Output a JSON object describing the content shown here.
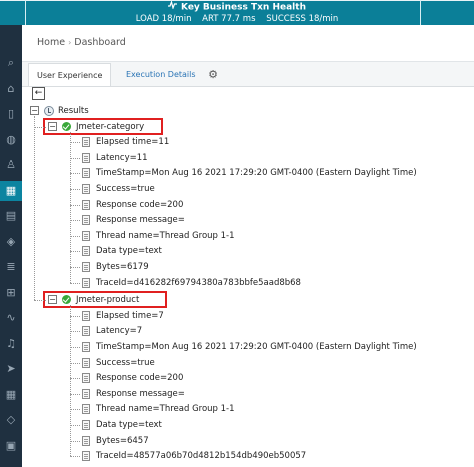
{
  "topbar": {
    "title": "Key Business Txn Health",
    "metrics": [
      {
        "label": "LOAD 18/min"
      },
      {
        "label": "ART 77.7 ms"
      },
      {
        "label": "SUCCESS 18/min"
      }
    ]
  },
  "sidebar": {
    "items": [
      {
        "icon": "search-icon",
        "glyph": "⌕"
      },
      {
        "icon": "home-icon",
        "glyph": "⌂"
      },
      {
        "icon": "tablet-icon",
        "glyph": "▯"
      },
      {
        "icon": "globe-icon",
        "glyph": "◍"
      },
      {
        "icon": "user-icon",
        "glyph": "♙"
      },
      {
        "icon": "map-icon",
        "glyph": "▦",
        "active": true
      },
      {
        "icon": "calendar-icon",
        "glyph": "▤"
      },
      {
        "icon": "cube-icon",
        "glyph": "◈"
      },
      {
        "icon": "layers-icon",
        "glyph": "≣"
      },
      {
        "icon": "network-icon",
        "glyph": "⊞"
      },
      {
        "icon": "pulse-icon",
        "glyph": "∿"
      },
      {
        "icon": "bell-icon",
        "glyph": "♫"
      },
      {
        "icon": "send-icon",
        "glyph": "➤"
      },
      {
        "icon": "grid-icon",
        "glyph": "▦"
      },
      {
        "icon": "tag-icon",
        "glyph": "◇"
      },
      {
        "icon": "briefcase-icon",
        "glyph": "▣"
      }
    ]
  },
  "breadcrumb": {
    "home": "Home",
    "separator": "›",
    "current": "Dashboard"
  },
  "tabs": {
    "user_experience": "User Experience",
    "execution_details": "Execution Details"
  },
  "tree": {
    "root": "Results",
    "nodes": [
      {
        "name": "Jmeter-category",
        "attributes": [
          "Elapsed time=11",
          "Latency=11",
          "TimeStamp=Mon Aug 16 2021 17:29:20 GMT-0400 (Eastern Daylight Time)",
          "Success=true",
          "Response code=200",
          "Response message=",
          "Thread name=Thread Group 1-1",
          "Data type=text",
          "Bytes=6179",
          "TraceId=d416282f69794380a783bbfe5aad8b68"
        ]
      },
      {
        "name": "Jmeter-product",
        "attributes": [
          "Elapsed time=7",
          "Latency=7",
          "TimeStamp=Mon Aug 16 2021 17:29:20 GMT-0400 (Eastern Daylight Time)",
          "Success=true",
          "Response code=200",
          "Response message=",
          "Thread name=Thread Group 1-1",
          "Data type=text",
          "Bytes=6457",
          "TraceId=48577a06b70d4812b154db490eb50057"
        ]
      }
    ]
  },
  "colors": {
    "topbar": "#0b7f98",
    "sidebar": "#1f3040",
    "sidebar_active": "#0c84a0",
    "highlight": "#e02020",
    "success": "#3aa83a"
  }
}
